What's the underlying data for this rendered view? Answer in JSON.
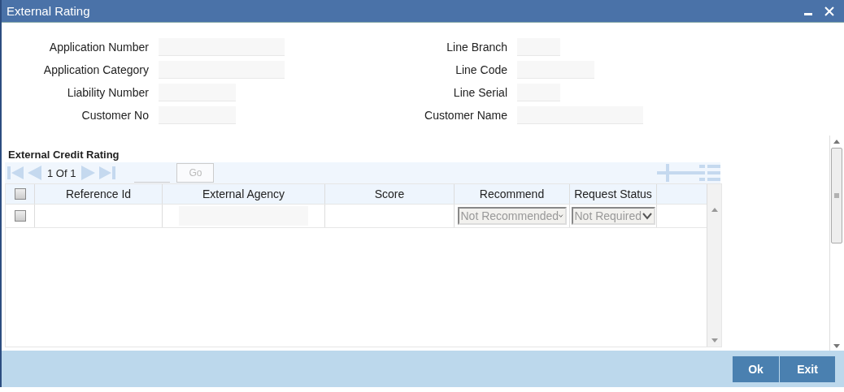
{
  "window": {
    "title": "External Rating"
  },
  "form": {
    "left": [
      {
        "label": "Application Number"
      },
      {
        "label": "Application Category"
      },
      {
        "label": "Liability Number"
      },
      {
        "label": "Customer No"
      }
    ],
    "right": [
      {
        "label": "Line Branch"
      },
      {
        "label": "Line Code"
      },
      {
        "label": "Line Serial"
      },
      {
        "label": "Customer Name"
      }
    ]
  },
  "section": {
    "title": "External Credit Rating",
    "pager": {
      "text": "1 Of 1",
      "go": "Go",
      "go_disabled": true
    },
    "table": {
      "select_all_checked": false,
      "columns": [
        "Reference Id",
        "External Agency",
        "Score",
        "Recommend",
        "Request Status"
      ],
      "rows": [
        {
          "checked": false,
          "recommend": "Not Recommended",
          "request_status": "Not Required"
        }
      ]
    }
  },
  "buttons": [
    "Ok",
    "Exit"
  ]
}
